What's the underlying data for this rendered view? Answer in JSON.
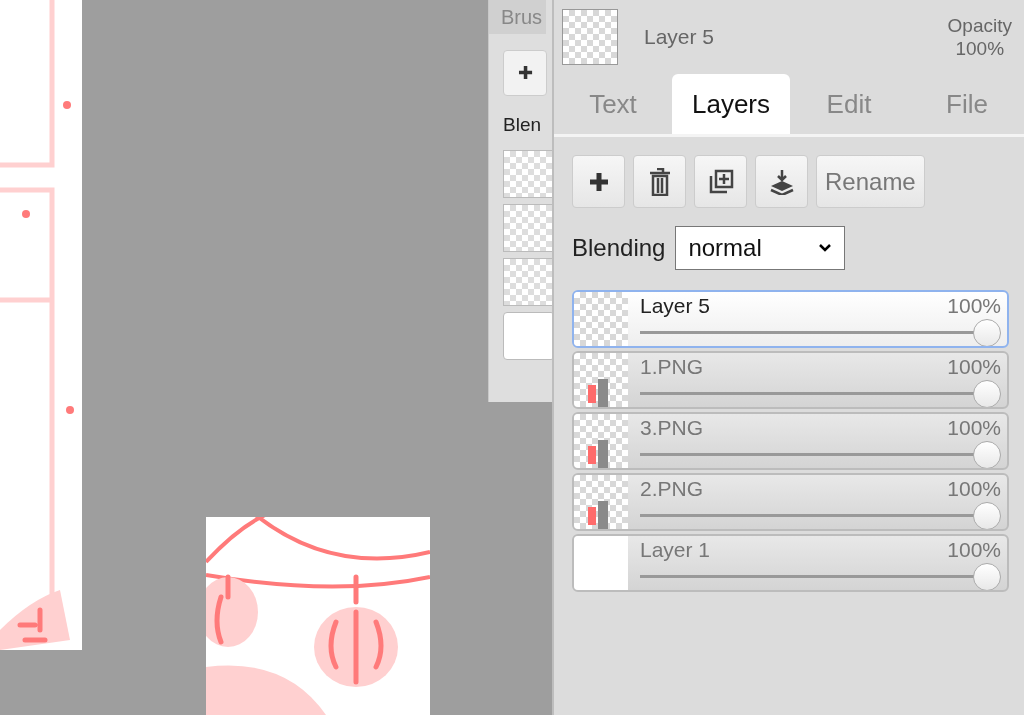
{
  "back_panel": {
    "tab": "Brus",
    "add": "✚",
    "label": "Blen"
  },
  "panel": {
    "current_layer": {
      "name": "Layer 5",
      "opacity_label": "Opacity",
      "opacity": "100%"
    },
    "tabs": [
      {
        "label": "Text",
        "selected": false
      },
      {
        "label": "Layers",
        "selected": true
      },
      {
        "label": "Edit",
        "selected": false
      },
      {
        "label": "File",
        "selected": false
      }
    ],
    "toolbar": {
      "rename": "Rename"
    },
    "blending": {
      "label": "Blending",
      "value": "normal"
    },
    "layers": [
      {
        "name": "Layer 5",
        "opacity": "100%",
        "level": 1,
        "selected": true,
        "kind": "transparent"
      },
      {
        "name": "1.PNG",
        "opacity": "100%",
        "level": 1,
        "selected": false,
        "kind": "content"
      },
      {
        "name": "3.PNG",
        "opacity": "100%",
        "level": 1,
        "selected": false,
        "kind": "content"
      },
      {
        "name": "2.PNG",
        "opacity": "100%",
        "level": 1,
        "selected": false,
        "kind": "content"
      },
      {
        "name": "Layer 1",
        "opacity": "100%",
        "level": 1,
        "selected": false,
        "kind": "white"
      }
    ]
  }
}
